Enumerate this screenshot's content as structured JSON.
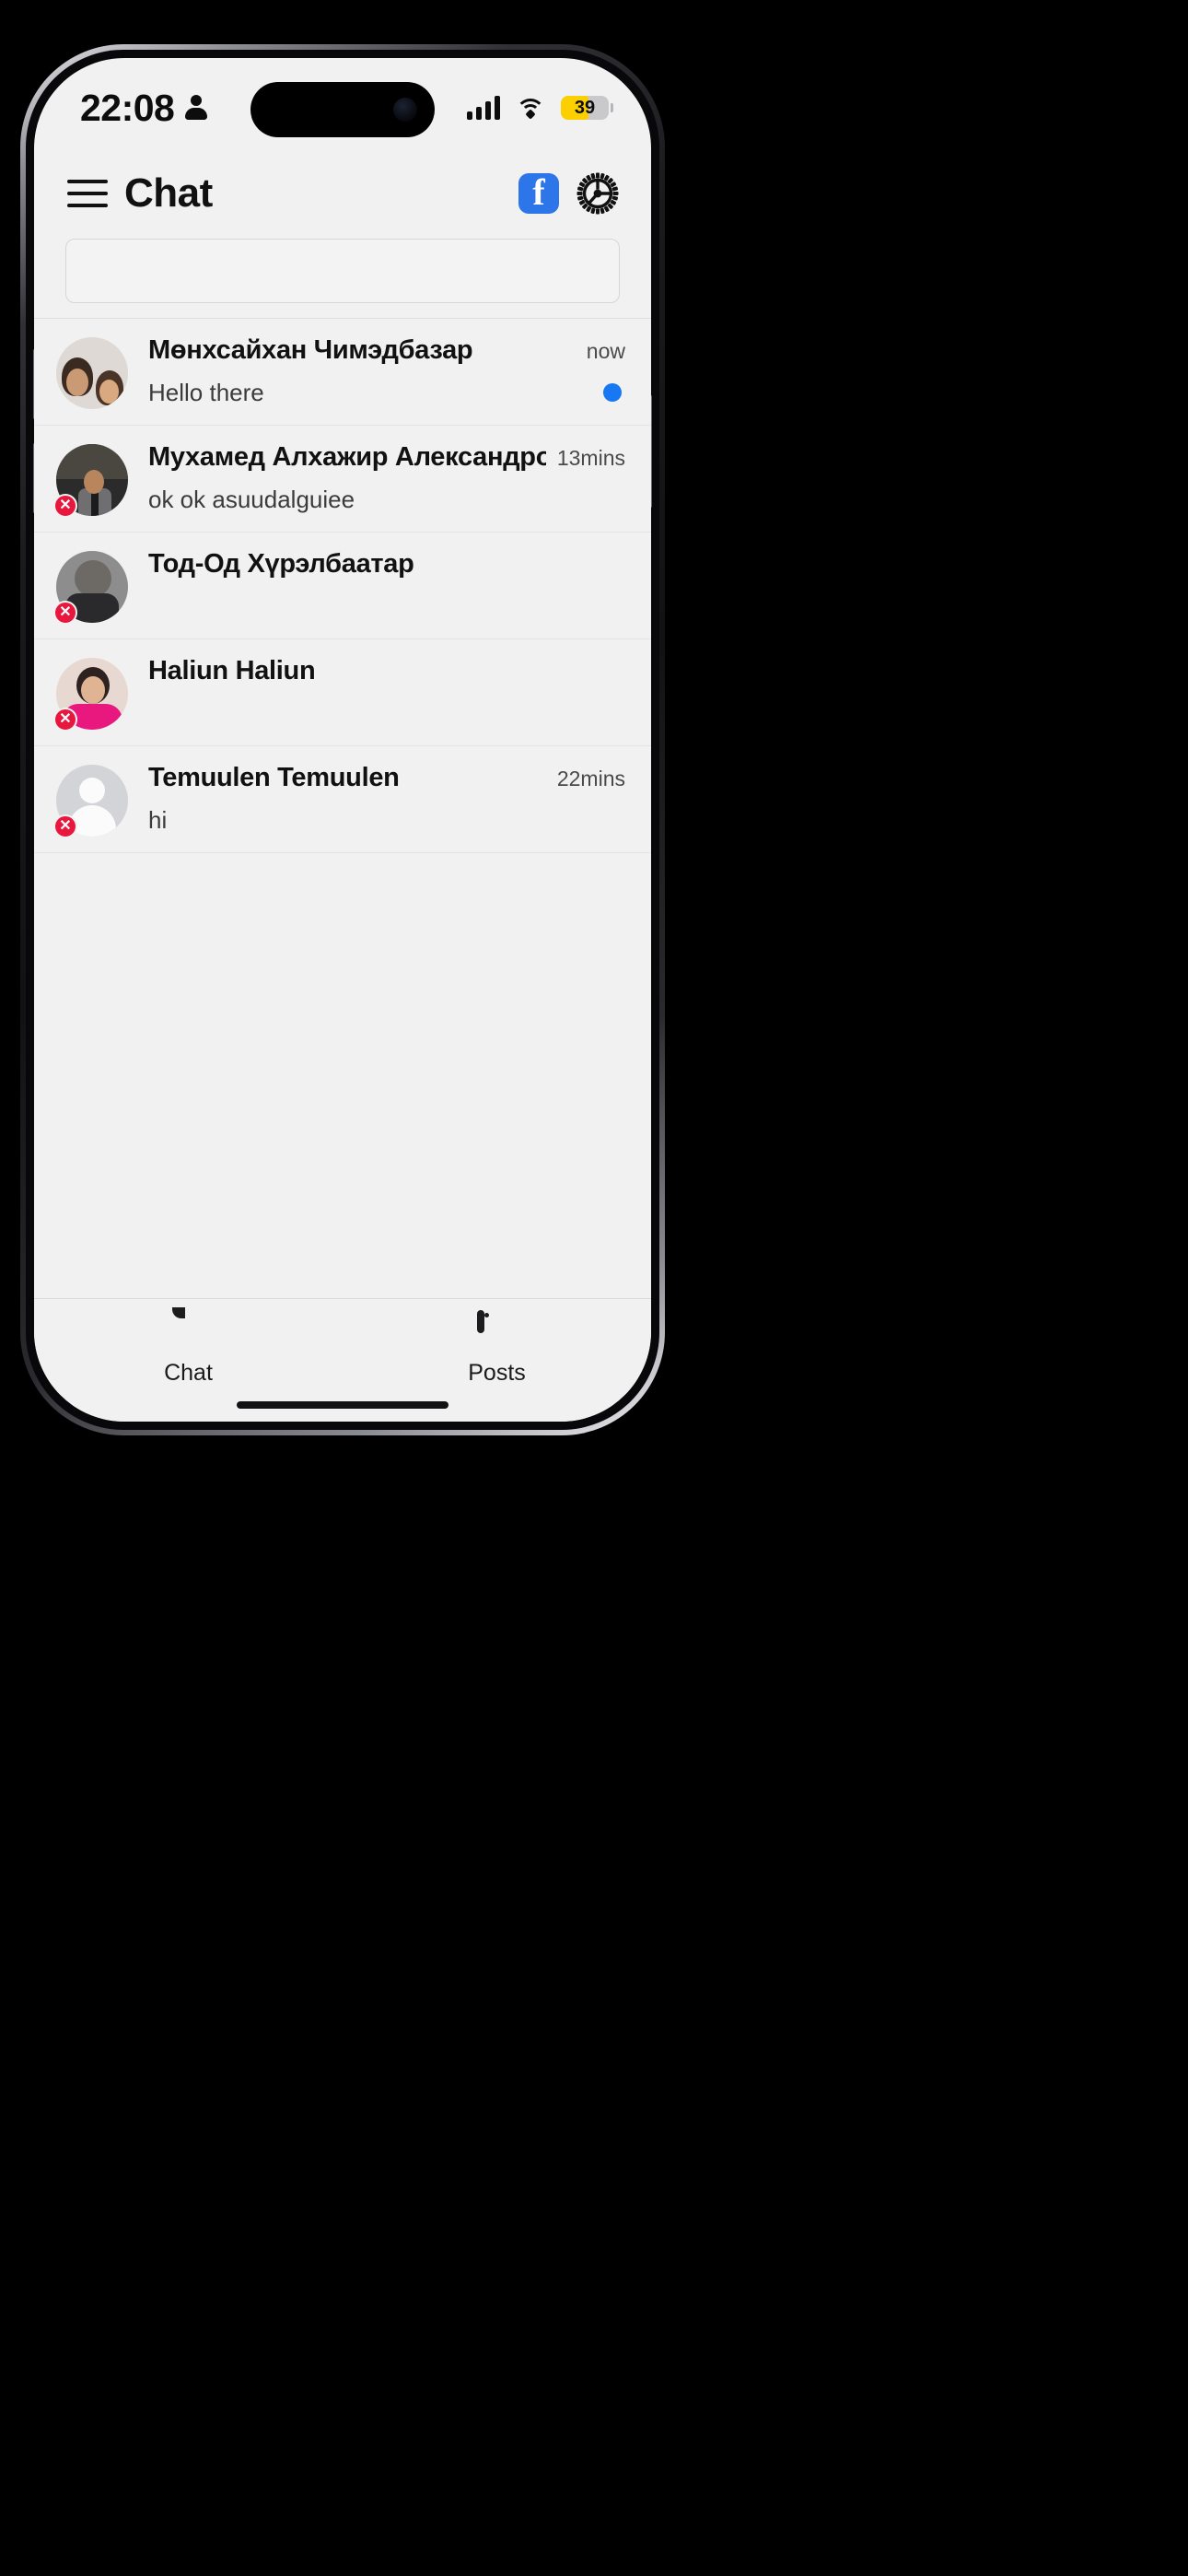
{
  "status_bar": {
    "time": "22:08",
    "person_icon": "person-icon",
    "signal_icon": "cellular-signal-icon",
    "wifi_icon": "wifi-icon",
    "battery_level": "39",
    "battery_color": "#fcd000"
  },
  "header": {
    "menu_icon": "hamburger-menu-icon",
    "title": "Chat",
    "facebook_icon": "facebook-icon",
    "facebook_color": "#2d76ea",
    "settings_icon": "gear-icon"
  },
  "search": {
    "value": "",
    "placeholder": ""
  },
  "chats": [
    {
      "name": "Мөнхсайхан Чимэдбазар",
      "time": "now",
      "snippet": "Hello there",
      "unread": true,
      "offline_badge": false,
      "badge_glyph": ""
    },
    {
      "name": "Мухамед Алхажир Александро",
      "time": "13mins",
      "snippet": "ok ok asuudalguiee",
      "unread": false,
      "offline_badge": true,
      "badge_glyph": "✕"
    },
    {
      "name": "Тод-Од Хүрэлбаатар",
      "time": "",
      "snippet": "",
      "unread": false,
      "offline_badge": true,
      "badge_glyph": "✕"
    },
    {
      "name": "Haliun Haliun",
      "time": "",
      "snippet": "",
      "unread": false,
      "offline_badge": true,
      "badge_glyph": "✕"
    },
    {
      "name": "Temuulen Temuulen",
      "time": "22mins",
      "snippet": "hi",
      "unread": false,
      "offline_badge": true,
      "badge_glyph": "✕"
    }
  ],
  "tabs": [
    {
      "label": "Chat",
      "icon": "chat-bubble-icon",
      "active": true
    },
    {
      "label": "Posts",
      "icon": "window-icon",
      "active": false
    }
  ],
  "colors": {
    "accent_blue": "#1877f2",
    "badge_red": "#e8173d",
    "screen_bg": "#f1f1f1"
  }
}
